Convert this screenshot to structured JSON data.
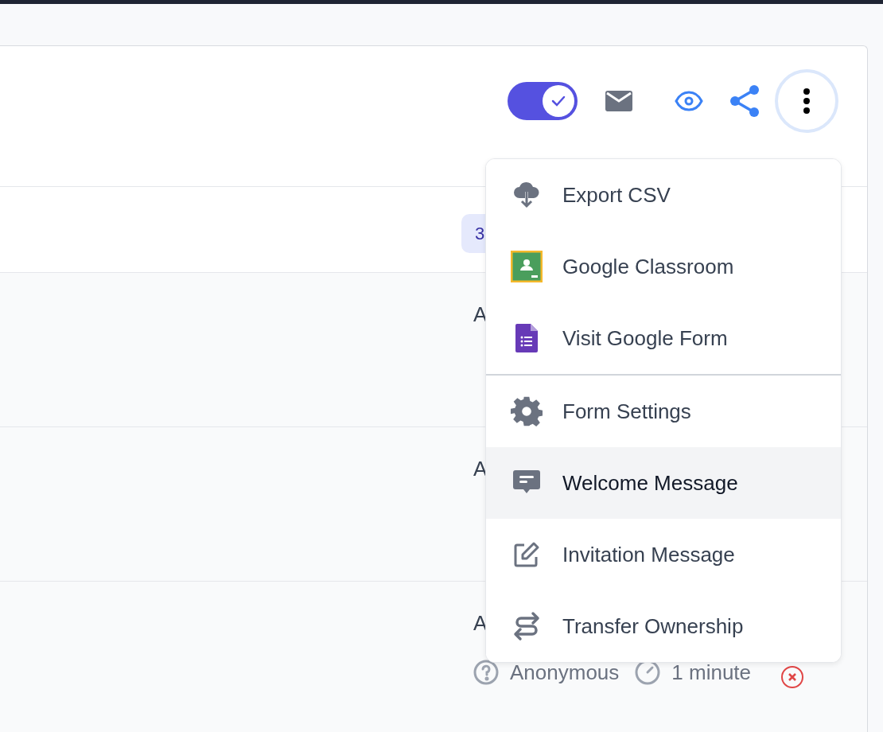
{
  "toolbar": {
    "toggle": {
      "on": true
    }
  },
  "rows": [
    {
      "kind": "badge",
      "badge": "3"
    },
    {
      "kind": "entry",
      "title": "A"
    },
    {
      "kind": "entry",
      "title": "A"
    },
    {
      "kind": "entry",
      "title": "A",
      "author": "Anonymous",
      "duration": "1 minute"
    }
  ],
  "menu": {
    "groups": [
      [
        {
          "kind": "cloud",
          "label": "Export CSV",
          "highlighted": false
        },
        {
          "kind": "classroom",
          "label": "Google Classroom",
          "highlighted": false
        },
        {
          "kind": "form",
          "label": "Visit Google Form",
          "highlighted": false
        }
      ],
      [
        {
          "kind": "gear",
          "label": "Form Settings",
          "highlighted": false
        },
        {
          "kind": "message",
          "label": "Welcome Message",
          "highlighted": true
        },
        {
          "kind": "edit",
          "label": "Invitation Message",
          "highlighted": false
        },
        {
          "kind": "transfer",
          "label": "Transfer Ownership",
          "highlighted": false
        }
      ]
    ]
  }
}
